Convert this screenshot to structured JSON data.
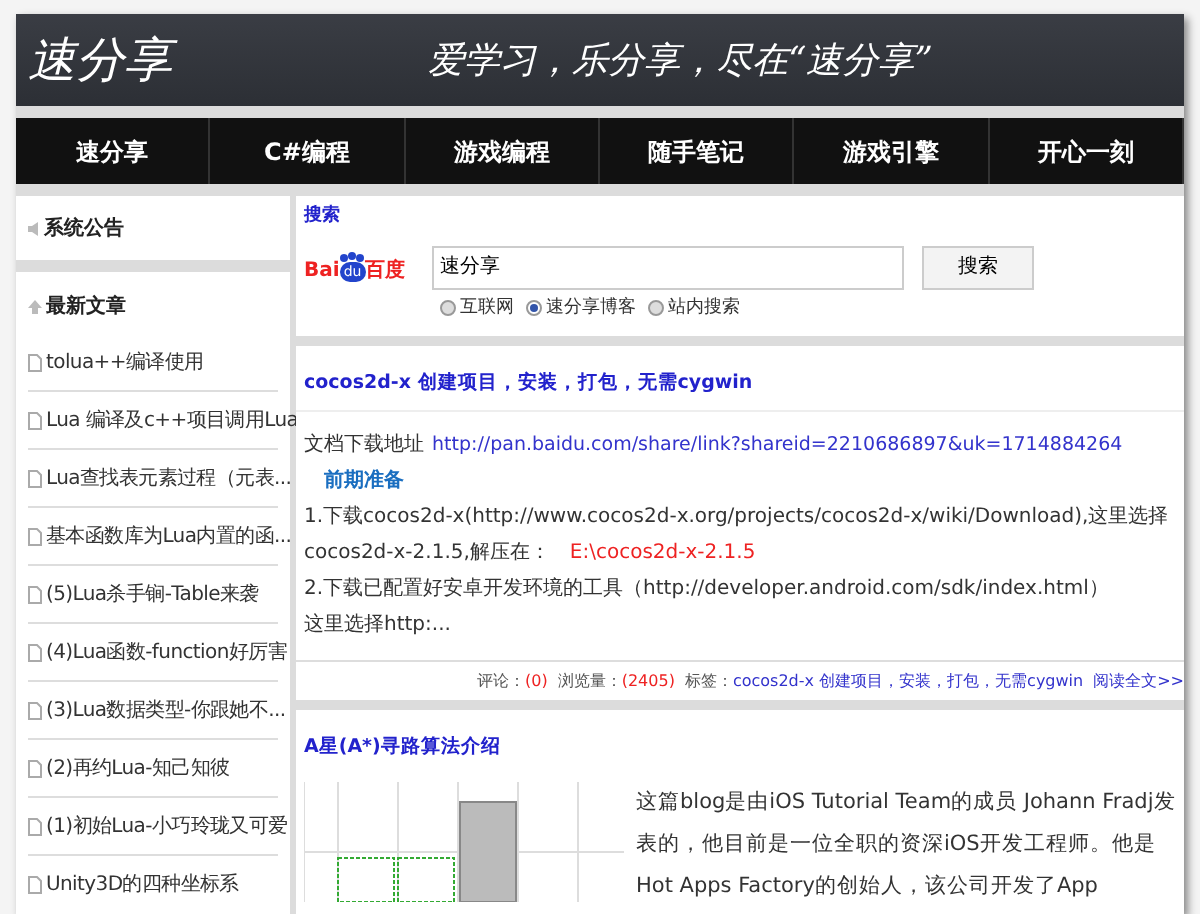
{
  "header": {
    "logo": "速分享",
    "slogan": "爱学习，乐分享，尽在“速分享”"
  },
  "nav": [
    {
      "label": "速分享"
    },
    {
      "label": "C#编程"
    },
    {
      "label": "游戏编程"
    },
    {
      "label": "随手笔记"
    },
    {
      "label": "游戏引擎"
    },
    {
      "label": "开心一刻"
    }
  ],
  "sidebar": {
    "notice_title": "系统公告",
    "recent_title": "最新文章",
    "articles": [
      "tolua++编译使用",
      "Lua 编译及c++项目调用Lua",
      "Lua查找表元素过程（元表...",
      "基本函数库为Lua内置的函...",
      "(5)Lua杀手锏-Table来袭",
      "(4)Lua函数-function好厉害",
      "(3)Lua数据类型-你跟她不...",
      "(2)再约Lua-知己知彼",
      "(1)初始Lua-小巧玲珑又可爱",
      "Unity3D的四种坐标系"
    ]
  },
  "search": {
    "title": "搜索",
    "logo": {
      "left": "Bai",
      "paw": "du",
      "right": "百度"
    },
    "value": "速分享",
    "button": "搜索",
    "options": [
      {
        "label": "互联网",
        "selected": false
      },
      {
        "label": "速分享博客",
        "selected": true
      },
      {
        "label": "站内搜索",
        "selected": false
      }
    ]
  },
  "posts": [
    {
      "title": "cocos2d-x 创建项目，安装，打包，无需cygwin",
      "lines": [
        {
          "kind": "link",
          "label": "文档下载地址",
          "text": "http://pan.baidu.com/share/link?shareid=2210686897&uk=1714884264"
        },
        {
          "kind": "heading",
          "text": "前期准备"
        },
        {
          "kind": "plain",
          "text": "1.下载cocos2d-x(http://www.cocos2d-x.org/projects/cocos2d-x/wiki/Download),这里选择"
        },
        {
          "kind": "path",
          "label": "cocos2d-x-2.1.5,解压在：",
          "text": "E:\\cocos2d-x-2.1.5"
        },
        {
          "kind": "plain",
          "text": "2.下载已配置好安卓开发环境的工具（http://developer.android.com/sdk/index.html）"
        },
        {
          "kind": "plain",
          "text": "这里选择http:..."
        }
      ],
      "footer": {
        "comments_label": "评论：",
        "comments": "(0)",
        "views_label": "浏览量：",
        "views": "(2405)",
        "tags_label": "标签：",
        "tags": "cocos2d-x 创建项目，安装，打包，无需cygwin",
        "read_more": "阅读全文>>"
      }
    },
    {
      "title": "A星(A*)寻路算法介绍",
      "text": "这篇blog是由iOS Tutorial Team的成员 Johann Fradj发表的，他目前是一位全职的资深iOS开发工程师。他是Hot Apps Factory的创始人，该公司开发了App"
    }
  ]
}
